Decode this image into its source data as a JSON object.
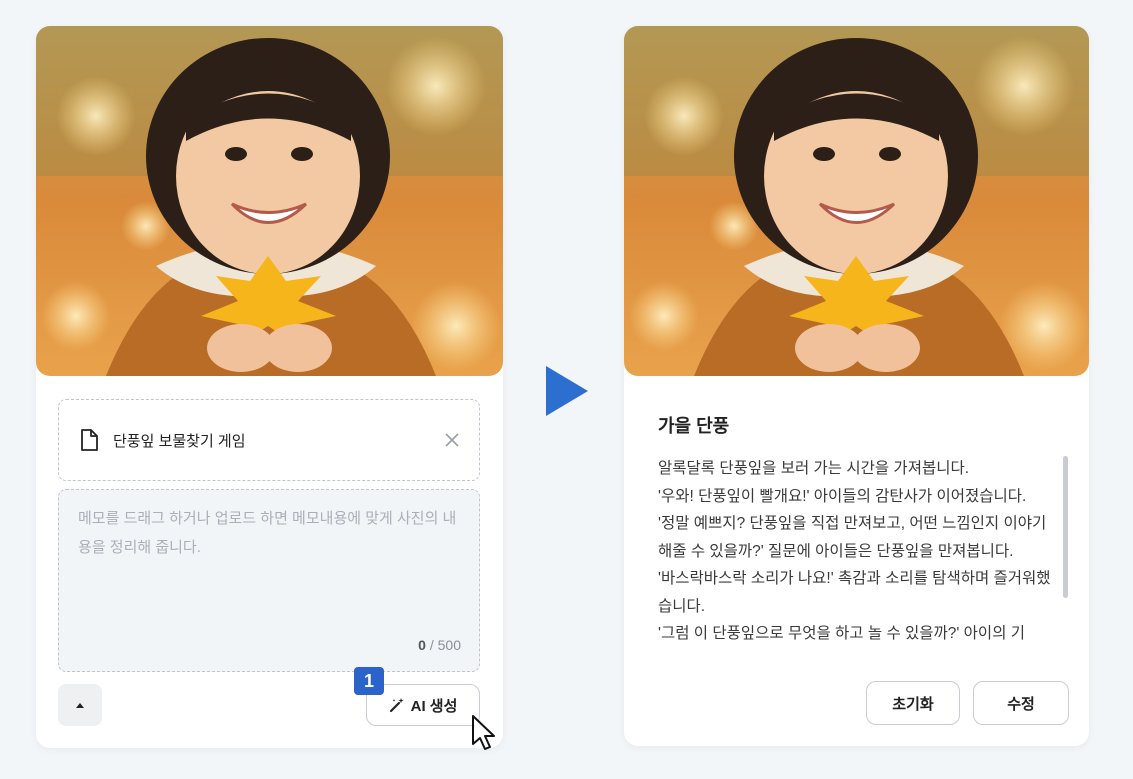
{
  "left_panel": {
    "photo_alt": "Child holding a yellow maple leaf in autumn",
    "attachment": {
      "file_name": "단풍잎 보물찾기 게임",
      "icon": "file-icon",
      "remove_icon": "close-icon"
    },
    "memo": {
      "value": "",
      "placeholder": "메모를 드래그 하거나 업로드 하면 메모내용에 맞게 사진의 내용을 정리해 줍니다.",
      "char_count": "0",
      "char_max": "500"
    },
    "collapse_icon": "caret-up-icon",
    "ai_button": {
      "label": "AI 생성",
      "icon": "magic-wand-icon"
    },
    "step_badge": "1"
  },
  "right_panel": {
    "photo_alt": "Child holding a yellow maple leaf in autumn",
    "title": "가을 단풍",
    "paragraphs": [
      "알록달록 단풍잎을 보러 가는 시간을 가져봅니다.",
      "'우와! 단풍잎이 빨개요!' 아이들의 감탄사가 이어졌습니다.",
      "'정말 예쁘지? 단풍잎을 직접 만져보고, 어떤 느낌인지 이야기해줄 수 있을까?' 질문에 아이들은 단풍잎을 만져봅니다.",
      "'바스락바스락 소리가 나요!' 촉감과 소리를 탐색하며 즐거워했습니다.",
      "'그럼 이 단풍잎으로 무엇을 하고 놀 수 있을까?' 아이의 기"
    ],
    "reset_label": "초기화",
    "edit_label": "수정"
  },
  "colors": {
    "accent": "#2a63c9",
    "arrow": "#2d6fd1"
  }
}
